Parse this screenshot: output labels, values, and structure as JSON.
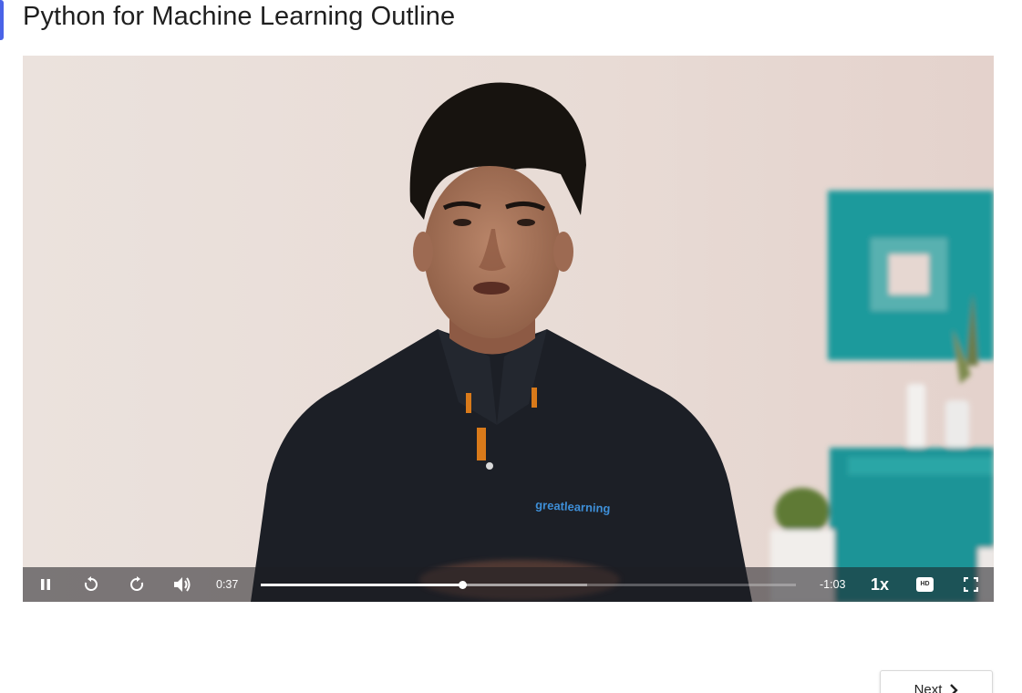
{
  "page": {
    "title": "Python for Machine Learning Outline"
  },
  "video": {
    "shirt_brand_text": "greatlearning",
    "current_time": "0:37",
    "remaining_time": "-1:03",
    "speed": "1x",
    "quality_badge": "HD",
    "progress_fraction": 0.376,
    "buffered_fraction": 0.61,
    "icons": {
      "pause": "pause-icon",
      "rewind": "rewind-icon",
      "forward": "forward-icon",
      "volume": "volume-icon",
      "fullscreen": "fullscreen-icon"
    }
  },
  "navigation": {
    "next_label": "Next"
  },
  "colors": {
    "accent": "#4a63e7",
    "wall": "#e7dbd6",
    "teal": "#1f9a9c",
    "shirt": "#1c1f26"
  }
}
